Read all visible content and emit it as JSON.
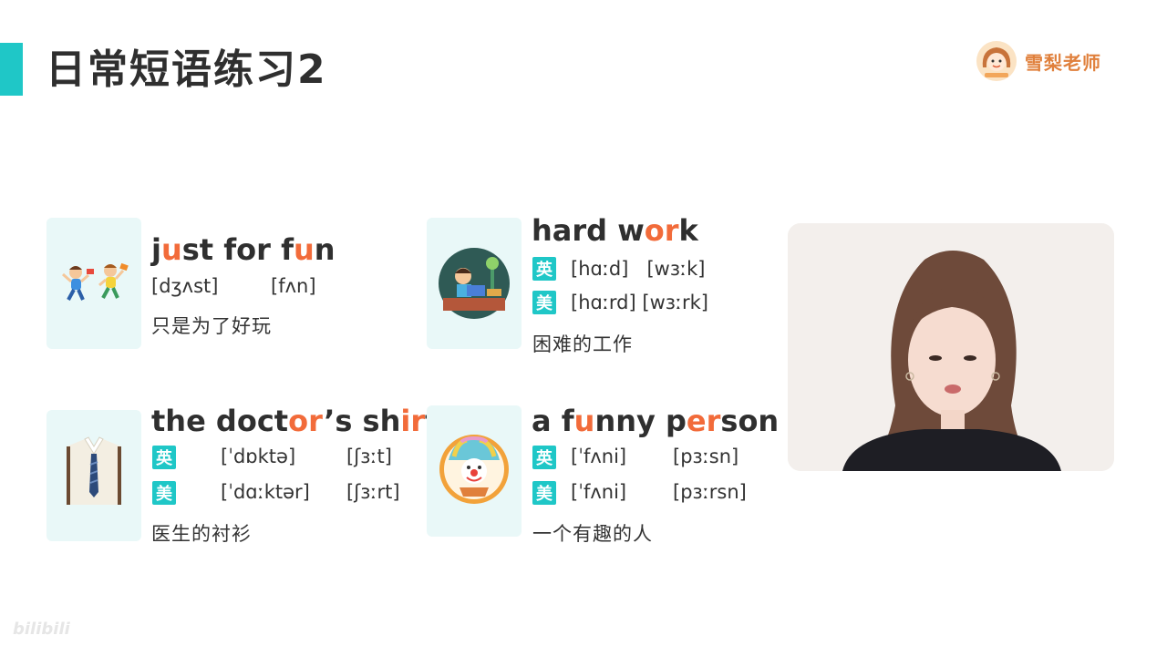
{
  "title": "日常短语练习2",
  "brand": {
    "name": "雪梨老师",
    "avatar_icon": "teacher-avatar-icon"
  },
  "colors": {
    "accent": "#1fc7c7",
    "highlight": "#f26b3a",
    "text": "#2f2f2f"
  },
  "cards": [
    {
      "icon": "kids-playing-icon",
      "phrase_parts": [
        "j",
        "u",
        "s",
        "t",
        " for f",
        "u",
        "n"
      ],
      "ipa_1": "[dʒʌst]",
      "ipa_2": "[fʌn]",
      "meaning": "只是为了好玩"
    },
    {
      "icon": "student-working-icon",
      "phrase_parts": [
        "hard w",
        "or",
        "k"
      ],
      "uk_label": "英",
      "us_label": "美",
      "uk_ipa": "[hɑːd]   [wɜːk]",
      "us_ipa": "[hɑːrd] [wɜːrk]",
      "meaning": "困难的工作"
    },
    {
      "icon": "shirt-tie-icon",
      "phrase_parts": [
        "the doct",
        "or",
        "’s sh",
        "ir",
        "t"
      ],
      "uk_label": "英",
      "us_label": "美",
      "uk_ipa_1": "[ˈdɒktə]",
      "uk_ipa_2": "[ʃɜːt]",
      "us_ipa_1": "[ˈdɑːktər]",
      "us_ipa_2": "[ʃɜːrt]",
      "meaning": "医生的衬衫"
    },
    {
      "icon": "clown-icon",
      "phrase_parts": [
        "a f",
        "u",
        "nny p",
        "er",
        "son"
      ],
      "uk_label": "英",
      "us_label": "美",
      "uk_ipa_1": "[ˈfʌni]",
      "uk_ipa_2": "[pɜːsn]",
      "us_ipa_1": "[ˈfʌni]",
      "us_ipa_2": "[pɜːrsn]",
      "meaning": "一个有趣的人"
    }
  ],
  "watermark": "bilibili"
}
